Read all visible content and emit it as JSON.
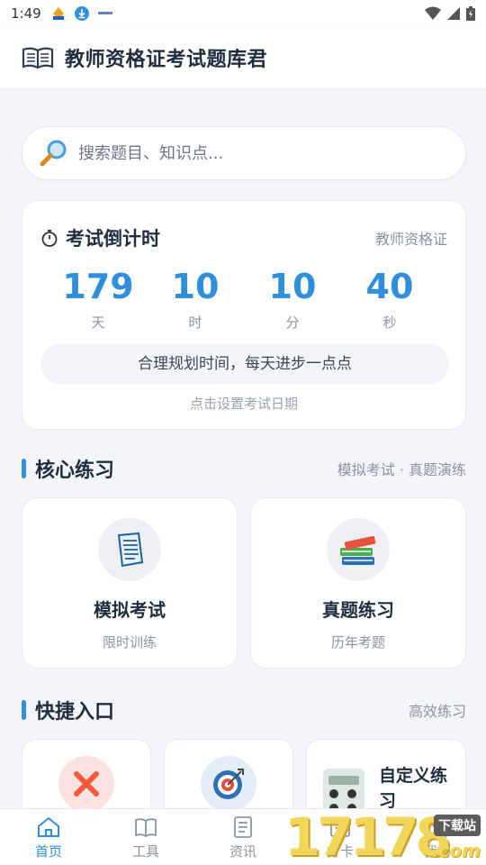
{
  "status_bar": {
    "time": "1:49"
  },
  "header": {
    "title": "教师资格证考试题库君"
  },
  "search": {
    "placeholder": "搜索题目、知识点..."
  },
  "countdown": {
    "title": "考试倒计时",
    "subtitle": "教师资格证",
    "units": [
      {
        "value": "179",
        "label": "天"
      },
      {
        "value": "10",
        "label": "时"
      },
      {
        "value": "10",
        "label": "分"
      },
      {
        "value": "40",
        "label": "秒"
      }
    ],
    "tip": "合理规划时间，每天进步一点点",
    "set_date": "点击设置考试日期"
  },
  "core": {
    "title": "核心练习",
    "subtitle": "模拟考试 · 真题演练",
    "cards": [
      {
        "title": "模拟考试",
        "sub": "限时训练",
        "icon": "document-icon"
      },
      {
        "title": "真题练习",
        "sub": "历年考题",
        "icon": "books-icon"
      }
    ]
  },
  "quick": {
    "title": "快捷入口",
    "subtitle": "高效练习",
    "cards": [
      {
        "icon": "wrong-answer-icon"
      },
      {
        "icon": "target-icon"
      },
      {
        "label": "自定义练习",
        "icon": "calculator-icon"
      }
    ]
  },
  "nav": {
    "items": [
      {
        "label": "首页",
        "icon": "home-icon"
      },
      {
        "label": "工具",
        "icon": "book-open-icon"
      },
      {
        "label": "资讯",
        "icon": "news-icon"
      },
      {
        "label": "打卡",
        "icon": "checkin-icon"
      },
      {
        "label": "我的",
        "icon": "profile-icon"
      }
    ]
  },
  "watermark": {
    "number": "17178",
    "badge": "下载站",
    "domain": ".com"
  },
  "colors": {
    "accent": "#2f8fdc",
    "background": "#f3f5f8",
    "wrong": "#ee5a3c"
  }
}
